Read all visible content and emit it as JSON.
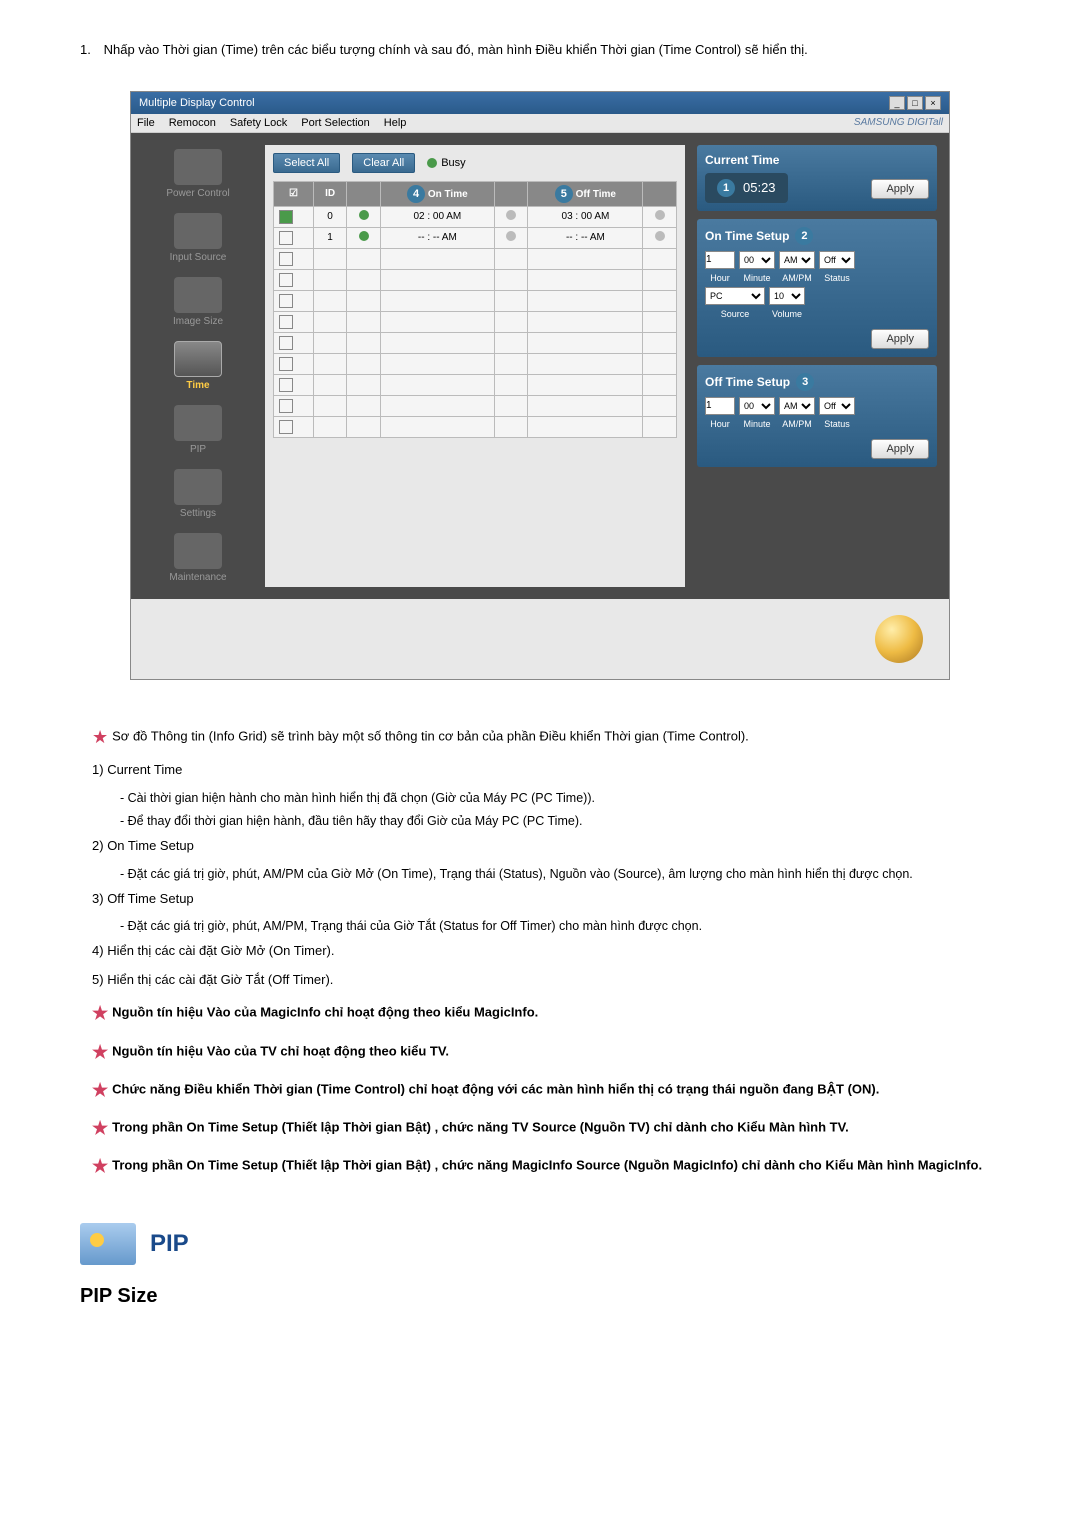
{
  "intro": {
    "num": "1.",
    "text": "Nhấp vào Thời gian (Time) trên các biểu tượng chính và sau đó, màn hình Điều khiển Thời gian (Time Control) sẽ hiển thị."
  },
  "window": {
    "title": "Multiple Display Control",
    "menubar": [
      "File",
      "Remocon",
      "Safety Lock",
      "Port Selection",
      "Help"
    ],
    "brand": "SAMSUNG DIGITall",
    "sidebar": [
      {
        "label": "Power Control",
        "active": false
      },
      {
        "label": "Input Source",
        "active": false
      },
      {
        "label": "Image Size",
        "active": false
      },
      {
        "label": "Time",
        "active": true
      },
      {
        "label": "PIP",
        "active": false
      },
      {
        "label": "Settings",
        "active": false
      },
      {
        "label": "Maintenance",
        "active": false
      }
    ],
    "buttons": {
      "select_all": "Select All",
      "clear_all": "Clear All",
      "busy": "Busy"
    },
    "grid": {
      "headers": [
        "",
        "ID",
        "",
        "On Time",
        "",
        "Off Time",
        ""
      ],
      "badge4": "4",
      "badge5": "5",
      "rows": [
        {
          "checked": true,
          "id": "0",
          "ind1": "green",
          "ontime": "02 : 00 AM",
          "ind2": "gray",
          "offtime": "03 : 00 AM",
          "ind3": "gray"
        },
        {
          "checked": false,
          "id": "1",
          "ind1": "green",
          "ontime": "-- : -- AM",
          "ind2": "gray",
          "offtime": "-- : -- AM",
          "ind3": "gray"
        }
      ]
    },
    "right": {
      "current": {
        "title": "Current Time",
        "badge": "1",
        "time": "05:23",
        "apply": "Apply"
      },
      "onsetup": {
        "title": "On Time Setup",
        "badge": "2",
        "hour": "1",
        "minute": "00",
        "ampm": "AM",
        "status": "Off",
        "labels": {
          "hour": "Hour",
          "minute": "Minute",
          "ampm": "AM/PM",
          "status": "Status",
          "source": "Source",
          "volume": "Volume"
        },
        "source": "PC",
        "volume": "10",
        "apply": "Apply"
      },
      "offsetup": {
        "title": "Off Time Setup",
        "badge": "3",
        "hour": "1",
        "minute": "00",
        "ampm": "AM",
        "status": "Off",
        "labels": {
          "hour": "Hour",
          "minute": "Minute",
          "ampm": "AM/PM",
          "status": "Status"
        },
        "apply": "Apply"
      }
    }
  },
  "notes": {
    "intro_star": "Sơ đồ Thông tin (Info Grid) sẽ trình bày một số thông tin cơ bản của phần Điều khiển Thời gian (Time Control).",
    "items": [
      {
        "num": "1)",
        "text": "Current Time",
        "subs": [
          "- Cài thời gian hiện hành cho màn hình hiển thị đã chọn (Giờ của Máy PC (PC Time)).",
          "- Để thay đổi thời gian hiện hành, đầu tiên hãy thay đổi Giờ của Máy PC (PC Time)."
        ]
      },
      {
        "num": "2)",
        "text": "On Time Setup",
        "subs": [
          "- Đặt các giá trị giờ, phút, AM/PM của Giờ Mở (On Time), Trạng thái (Status), Nguồn vào (Source), âm lượng cho màn hình hiển thị được chọn."
        ]
      },
      {
        "num": "3)",
        "text": "Off Time Setup",
        "subs": [
          "- Đặt các giá trị giờ, phút, AM/PM, Trạng thái của Giờ Tắt (Status for Off Timer) cho màn hình được chọn."
        ]
      },
      {
        "num": "4)",
        "text": "Hiển thị các cài đặt Giờ Mở (On Timer)."
      },
      {
        "num": "5)",
        "text": "Hiển thị các cài đặt Giờ Tắt (Off Timer)."
      }
    ],
    "stars": [
      "Nguồn tín hiệu Vào của MagicInfo chỉ hoạt động theo kiểu MagicInfo.",
      "Nguồn tín hiệu Vào của TV chỉ hoạt động theo kiểu TV.",
      "Chức năng Điều khiển Thời gian (Time Control) chỉ hoạt động với các màn hình hiển thị có trạng thái nguồn đang BẬT (ON).",
      "Trong phần On Time Setup (Thiết lập Thời gian Bật) , chức năng TV Source (Nguồn TV) chỉ dành cho Kiểu Màn hình TV.",
      "Trong phần On Time Setup (Thiết lập Thời gian Bật) , chức năng MagicInfo Source (Nguồn MagicInfo) chỉ dành cho Kiểu Màn hình MagicInfo."
    ]
  },
  "pip": {
    "label": "PIP",
    "size_label": "PIP Size"
  }
}
